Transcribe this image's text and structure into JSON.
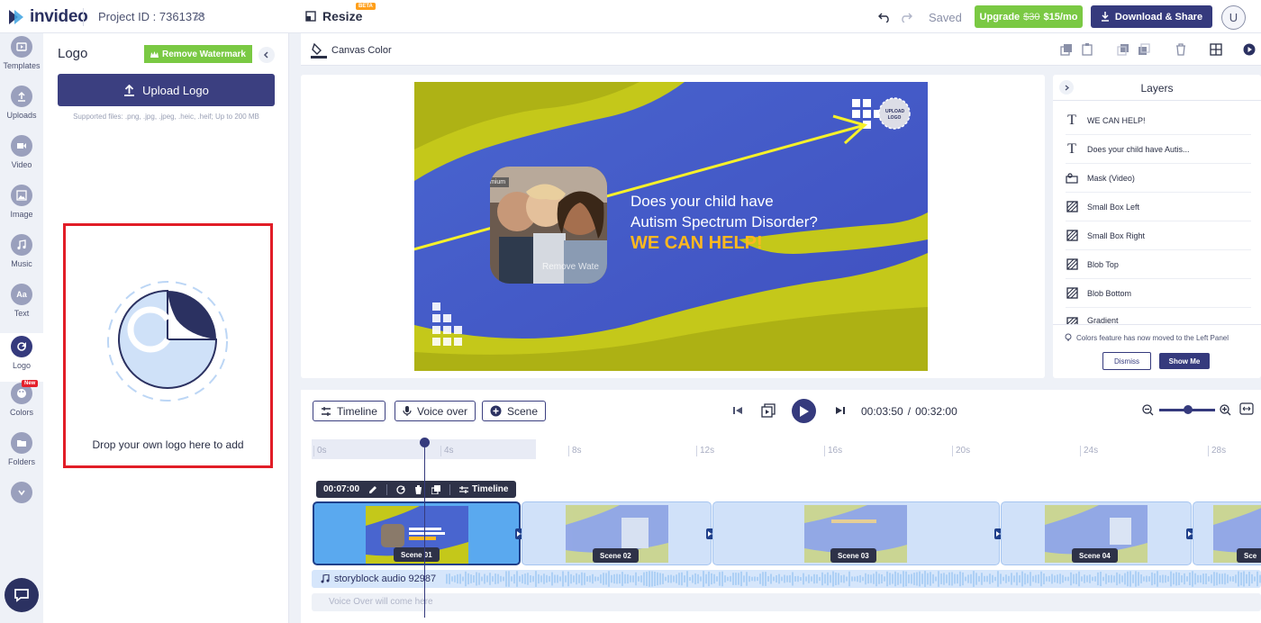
{
  "header": {
    "brand": "invideo",
    "project_id": "Project ID : 7361378",
    "resize_label": "Resize",
    "beta_badge": "BETA",
    "saved_status": "Saved",
    "upgrade_prefix": "Upgrade",
    "upgrade_old_price": "$30",
    "upgrade_new_price": "$15/mo",
    "download_label": "Download & Share",
    "avatar_initial": "U"
  },
  "left_nav": {
    "items": [
      {
        "label": "Templates",
        "icon": "templates-icon"
      },
      {
        "label": "Uploads",
        "icon": "upload-icon"
      },
      {
        "label": "Video",
        "icon": "video-icon"
      },
      {
        "label": "Image",
        "icon": "image-icon"
      },
      {
        "label": "Music",
        "icon": "music-icon"
      },
      {
        "label": "Text",
        "icon": "text-icon"
      },
      {
        "label": "Logo",
        "icon": "logo-icon",
        "active": true
      },
      {
        "label": "Colors",
        "icon": "palette-icon",
        "badge": "New"
      },
      {
        "label": "Folders",
        "icon": "folder-icon"
      }
    ]
  },
  "logo_panel": {
    "title": "Logo",
    "remove_watermark": "Remove Watermark",
    "upload_button": "Upload Logo",
    "supported_files": "Supported files: .png, .jpg, .jpeg, .heic, .heif; Up to 200 MB",
    "drop_text": "Drop your own logo here to add"
  },
  "canvas_toolbar": {
    "canvas_color": "Canvas Color"
  },
  "video_frame": {
    "headline_1": "Does your child have",
    "headline_2": "Autism Spectrum Disorder?",
    "cta": "WE CAN HELP!",
    "premium_tag": "mium",
    "remove_watermark_overlay": "Remove Wate",
    "upload_logo_line1": "UPLOAD",
    "upload_logo_line2": "LOGO"
  },
  "layers": {
    "title": "Layers",
    "items": [
      {
        "label": "WE CAN HELP!",
        "icon": "text-layer-icon"
      },
      {
        "label": "Does your child have Autis...",
        "icon": "text-layer-icon"
      },
      {
        "label": "Mask (Video)",
        "icon": "mask-icon"
      },
      {
        "label": "Small Box Left",
        "icon": "shape-icon"
      },
      {
        "label": "Small Box Right",
        "icon": "shape-icon"
      },
      {
        "label": "Blob Top",
        "icon": "shape-icon"
      },
      {
        "label": "Blob Bottom",
        "icon": "shape-icon"
      },
      {
        "label": "Gradient",
        "icon": "shape-icon"
      }
    ],
    "note": "Colors feature has now moved to the Left Panel",
    "dismiss": "Dismiss",
    "show_me": "Show Me"
  },
  "timeline": {
    "tabs": [
      "Timeline",
      "Voice over",
      "Scene"
    ],
    "current_time": "00:03:50",
    "separator": "/",
    "total_time": "00:32:00",
    "ruler_ticks": [
      "0s",
      "4s",
      "8s",
      "12s",
      "16s",
      "20s",
      "24s",
      "28s"
    ],
    "scene_toolbar": {
      "duration": "00:07:00",
      "timeline_label": "Timeline"
    },
    "scenes": [
      "Scene 01",
      "Scene 02",
      "Scene 03",
      "Scene 04",
      "Sce"
    ],
    "audio_track": "storyblock audio 92987",
    "voice_placeholder": "Voice Over will come here"
  },
  "colors": {
    "primary": "#353a7d",
    "accent_green": "#7ac943",
    "frame_blue": "#4a5fc9",
    "frame_yellow": "#c4c81a",
    "cta_orange": "#ffb81f",
    "highlight_red": "#e11d27"
  }
}
